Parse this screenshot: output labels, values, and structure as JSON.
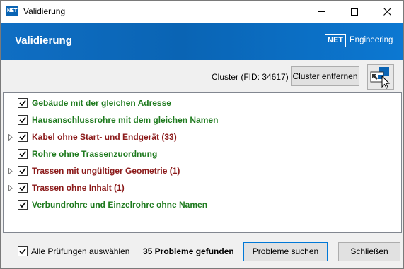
{
  "window": {
    "title": "Validierung",
    "app_icon_text": "NET",
    "controls": [
      "minimize",
      "maximize",
      "close"
    ]
  },
  "header": {
    "title": "Validierung",
    "logo_box": "NET",
    "logo_text": "Engineering",
    "gradient_colors": [
      "#0f6ec3",
      "#0c78d2"
    ]
  },
  "cluster": {
    "label": "Cluster (FID: 34617)",
    "remove_button": "Cluster entfernen",
    "map_button_icon": "map-select-icon"
  },
  "checks": [
    {
      "label": "Gebäude mit der gleichen Adresse",
      "checked": true,
      "expandable": false,
      "status": "ok"
    },
    {
      "label": "Hausanschlussrohre mit dem gleichen Namen",
      "checked": true,
      "expandable": false,
      "status": "ok"
    },
    {
      "label": "Kabel ohne Start- und Endgerät (33)",
      "checked": true,
      "expandable": true,
      "status": "error"
    },
    {
      "label": "Rohre ohne Trassenzuordnung",
      "checked": true,
      "expandable": false,
      "status": "ok"
    },
    {
      "label": "Trassen mit ungültiger Geometrie (1)",
      "checked": true,
      "expandable": true,
      "status": "error"
    },
    {
      "label": "Trassen ohne Inhalt (1)",
      "checked": true,
      "expandable": true,
      "status": "error"
    },
    {
      "label": "Verbundrohre und Einzelrohre ohne Namen",
      "checked": true,
      "expandable": false,
      "status": "ok"
    }
  ],
  "colors": {
    "ok": "#1e7a1e",
    "error": "#8b1a1a",
    "accent": "#0a64b4"
  },
  "footer": {
    "select_all_label": "Alle Prüfungen auswählen",
    "select_all_checked": true,
    "problems_found": "35 Probleme gefunden",
    "search_button": "Probleme suchen",
    "close_button": "Schließen"
  }
}
